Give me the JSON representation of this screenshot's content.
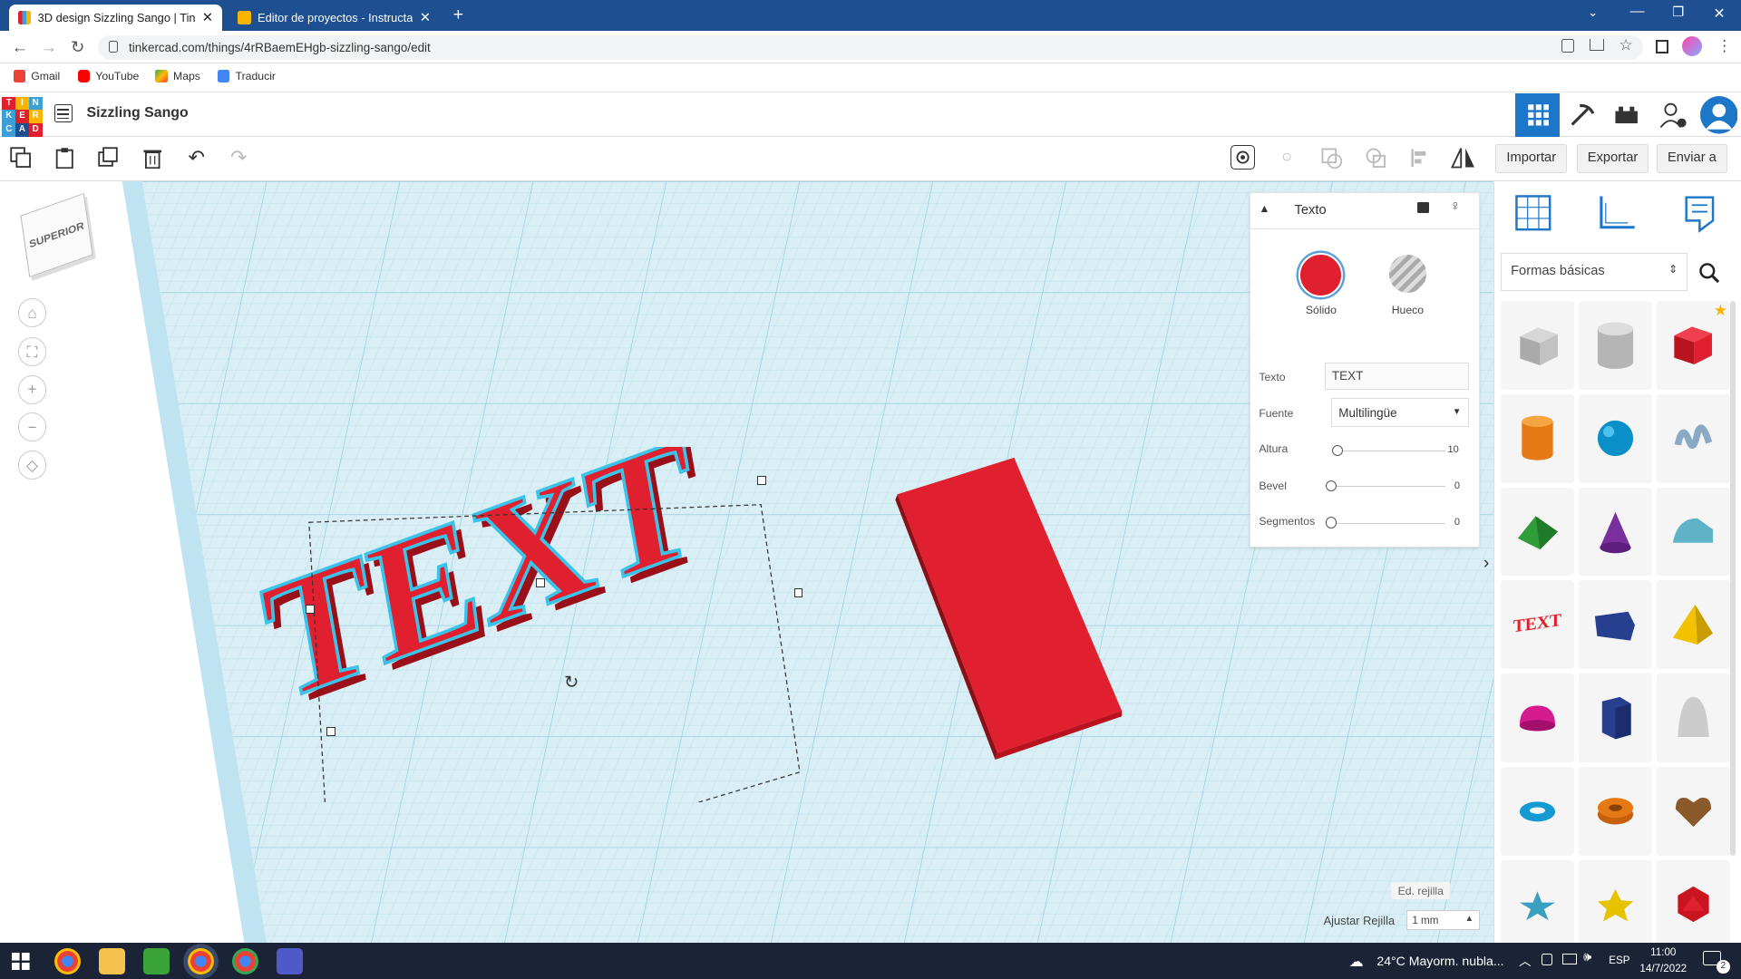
{
  "browser": {
    "tabs": [
      {
        "title": "3D design Sizzling Sango | Tinkercad",
        "active": true
      },
      {
        "title": "Editor de proyectos - Instructables",
        "active": false
      }
    ],
    "url": "tinkercad.com/things/4rRBaemEHgb-sizzling-sango/edit",
    "bookmarks": [
      "Gmail",
      "YouTube",
      "Maps",
      "Traducir"
    ]
  },
  "header": {
    "logo_letters": [
      "T",
      "I",
      "N",
      "K",
      "E",
      "R",
      "C",
      "A",
      "D"
    ],
    "project_title": "Sizzling Sango"
  },
  "toolbar": {
    "import_label": "Importar",
    "export_label": "Exportar",
    "send_label": "Enviar a"
  },
  "viewcube": {
    "label": "SUPERIOR"
  },
  "inspector": {
    "title": "Texto",
    "solid_label": "Sólido",
    "hole_label": "Hueco",
    "fields": {
      "text_label": "Texto",
      "text_value": "TEXT",
      "font_label": "Fuente",
      "font_value": "Multilingüe",
      "height_label": "Altura",
      "height_value": "10",
      "bevel_label": "Bevel",
      "bevel_value": "0",
      "segments_label": "Segmentos",
      "segments_value": "0"
    }
  },
  "shape_library": {
    "category": "Formas básicas"
  },
  "workplane": {
    "text_object": "TEXT",
    "edit_grid_label": "Ed. rejilla",
    "snap_grid_label": "Ajustar Rejilla",
    "snap_grid_value": "1 mm"
  },
  "taskbar": {
    "weather": "24°C  Mayorm. nubla...",
    "lang": "ESP",
    "time": "11:00",
    "date": "14/7/2022",
    "notif_count": "2"
  },
  "colors": {
    "brand_blue": "#1d4f91",
    "shape_red": "#e0202e",
    "grid_bg": "#d9eef5"
  }
}
